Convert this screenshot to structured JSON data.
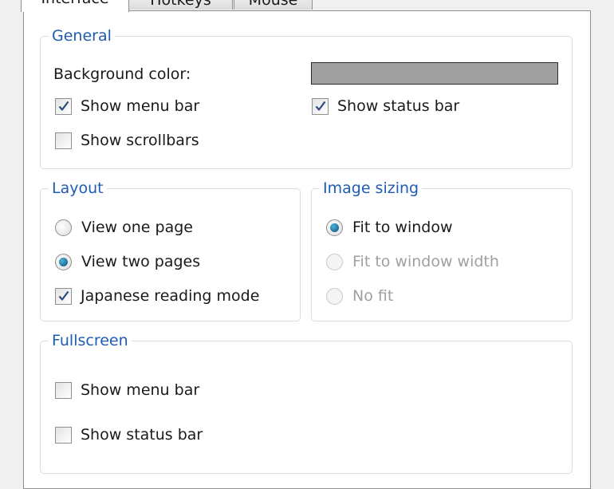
{
  "tabs": {
    "interface": "Interface",
    "hotkeys": "Hotkeys",
    "mouse": "Mouse"
  },
  "general": {
    "title": "General",
    "background_color_label": "Background color:",
    "background_color_value": "#a0a0a0",
    "show_menu_bar": {
      "label": "Show menu bar",
      "checked": true
    },
    "show_status_bar": {
      "label": "Show status bar",
      "checked": true
    },
    "show_scrollbars": {
      "label": "Show scrollbars",
      "checked": false
    }
  },
  "layout": {
    "title": "Layout",
    "view_one_page": {
      "label": "View one page",
      "selected": false
    },
    "view_two_pages": {
      "label": "View two pages",
      "selected": true
    },
    "japanese_reading_mode": {
      "label": "Japanese reading mode",
      "checked": true
    }
  },
  "image_sizing": {
    "title": "Image sizing",
    "fit_to_window": {
      "label": "Fit to window",
      "selected": true,
      "enabled": true
    },
    "fit_to_window_width": {
      "label": "Fit to window width",
      "selected": false,
      "enabled": false
    },
    "no_fit": {
      "label": "No fit",
      "selected": false,
      "enabled": false
    }
  },
  "fullscreen": {
    "title": "Fullscreen",
    "show_menu_bar": {
      "label": "Show menu bar",
      "checked": false
    },
    "show_status_bar": {
      "label": "Show status bar",
      "checked": false
    }
  },
  "colors": {
    "accent": "#1e5cb3",
    "radio_selected": "#0b4f7a",
    "checkmark": "#2b4a7f"
  },
  "icons": {
    "checkmark": "checkmark-icon",
    "radio_dot": "radio-dot-icon"
  }
}
